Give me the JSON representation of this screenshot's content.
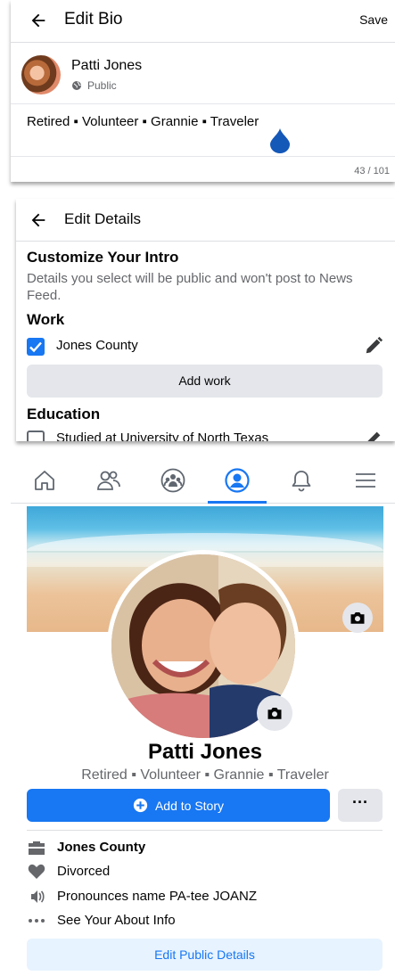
{
  "edit_bio": {
    "title": "Edit Bio",
    "save_label": "Save",
    "user_name": "Patti Jones",
    "privacy": "Public",
    "bio_text": "Retired ▪ Volunteer ▪ Grannie ▪ Traveler",
    "char_count": "43 / 101"
  },
  "edit_details": {
    "title": "Edit Details",
    "heading": "Customize Your Intro",
    "description": "Details you select will be public and won't post to News Feed.",
    "work_heading": "Work",
    "work_item": "Jones County",
    "work_checked": true,
    "add_work_label": "Add work",
    "education_heading": "Education",
    "education_item": "Studied at University of North Texas",
    "education_checked": false
  },
  "nav": {
    "items": [
      "home-icon",
      "friends-icon",
      "groups-icon",
      "profile-icon",
      "notifications-icon",
      "menu-icon"
    ],
    "active": "profile-icon"
  },
  "profile": {
    "name": "Patti Jones",
    "bio": "Retired ▪ Volunteer ▪ Grannie ▪ Traveler",
    "add_story_label": "Add to Story",
    "more_label": "···",
    "details": [
      {
        "icon": "briefcase-icon",
        "text": "Jones County"
      },
      {
        "icon": "heart-icon",
        "text": "Divorced"
      },
      {
        "icon": "speaker-icon",
        "text": "Pronounces name PA-tee JOANZ"
      },
      {
        "icon": "more-dots-icon",
        "text": "See Your About Info"
      }
    ],
    "edit_public_label": "Edit Public Details"
  },
  "colors": {
    "accent": "#1877f2",
    "secondary_text": "#65676b",
    "button_gray": "#e4e6eb",
    "light_blue": "#e7f3ff"
  }
}
